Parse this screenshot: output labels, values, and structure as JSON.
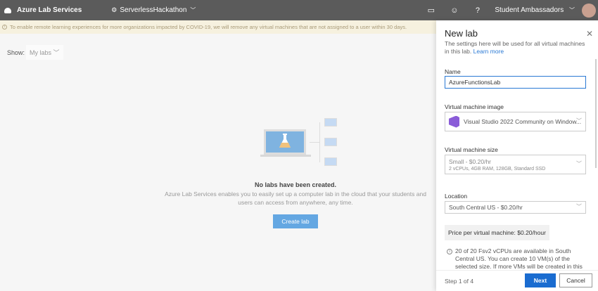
{
  "topbar": {
    "app_name": "Azure Lab Services",
    "workspace": "ServerlessHackathon",
    "account": "Student Ambassadors"
  },
  "banner": {
    "text": "To enable remote learning experiences for more organizations impacted by COVID-19, we will remove any virtual machines that are not assigned to a user within 30 days."
  },
  "filter": {
    "label": "Show:",
    "value": "My labs"
  },
  "empty": {
    "title": "No labs have been created.",
    "description": "Azure Lab Services enables you to easily set up a computer lab in the cloud that your students and users can access from anywhere, any time.",
    "button": "Create lab"
  },
  "panel": {
    "title": "New lab",
    "subtitle": "The settings here will be used for all virtual machines in this lab.",
    "learn_more": "Learn more",
    "name_label": "Name",
    "name_value": "AzureFunctionsLab",
    "image_label": "Virtual machine image",
    "image_value": "Visual Studio 2022 Community on Window...",
    "size_label": "Virtual machine size",
    "size_value": "Small - $0.20/hr",
    "size_detail": "2 vCPUs, 4GB RAM, 128GB, Standard SSD",
    "location_label": "Location",
    "location_value": "South Central US - $0.20/hr",
    "price": "Price per virtual machine: $0.20/hour",
    "info": "20 of 20 Fsv2 vCPUs are available in South Central US. You can create 10 VM(s) of the selected size. If more VMs will be created in this lab, you need to",
    "step": "Step 1 of 4",
    "next": "Next",
    "cancel": "Cancel"
  }
}
